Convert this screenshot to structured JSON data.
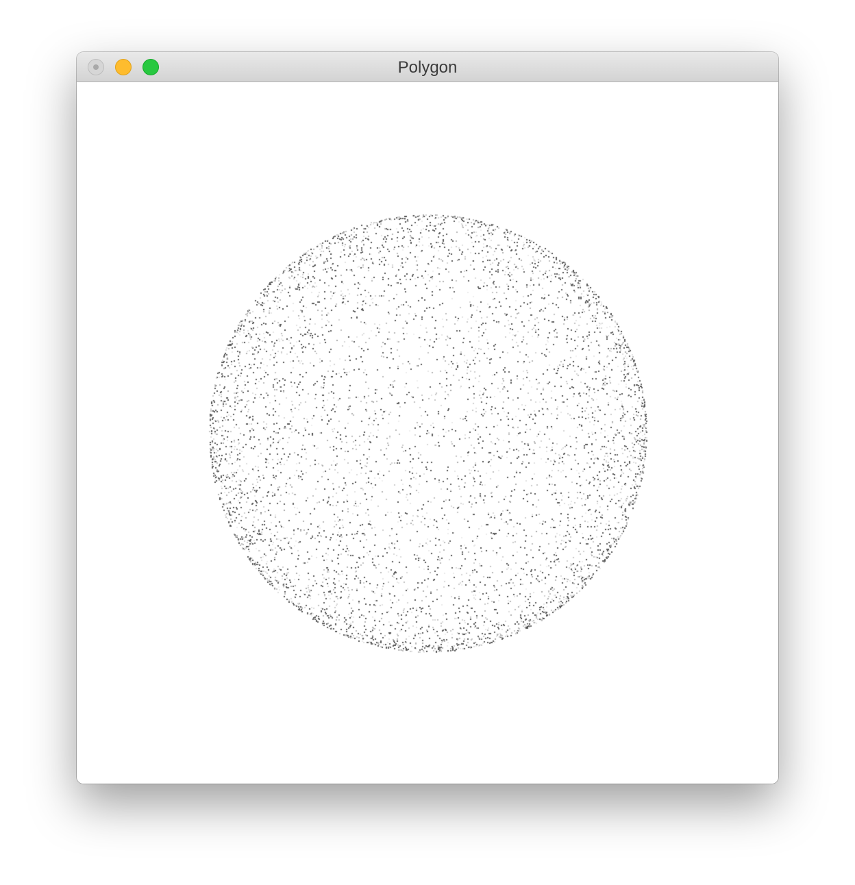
{
  "window": {
    "title": "Polygon"
  },
  "title_bar_buttons": {
    "close": "close-button",
    "minimize": "minimize-button",
    "zoom": "zoom-button"
  },
  "colors": {
    "minimize": "#febc2e",
    "zoom": "#28c840",
    "close_disabled": "#d6d6d6",
    "point_dark": "#5a5a5a",
    "point_light": "#d8d8d8",
    "background": "#ffffff"
  },
  "scene": {
    "description_shape": "sphere",
    "point_count": 6000
  }
}
